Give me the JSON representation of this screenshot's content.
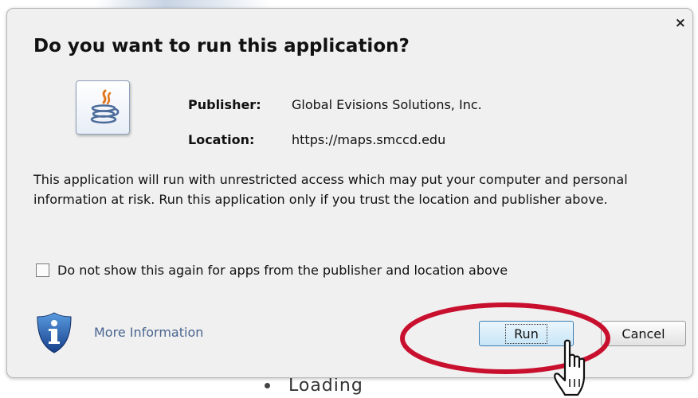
{
  "dialog": {
    "title": "Do you want to run this application?",
    "close_label": "×",
    "publisher_label": "Publisher:",
    "publisher_value": "Global Evisions Solutions, Inc.",
    "location_label": "Location:",
    "location_value": "https://maps.smccd.edu",
    "warning_text": "This application will run with unrestricted access which may put your computer and personal information at risk. Run this application only if you trust the location and publisher above.",
    "checkbox_label": "Do not show this again for apps from the publisher and location above",
    "checkbox_checked": false,
    "more_info_label": "More Information",
    "run_label": "Run",
    "cancel_label": "Cancel"
  },
  "background": {
    "loading_text": "Loading"
  },
  "icons": {
    "app_icon": "java-icon",
    "info_icon": "shield-info-icon",
    "cursor": "hand-pointer-icon"
  },
  "colors": {
    "dialog_bg": "#f0f0f0",
    "link": "#4a6590",
    "run_button_border": "#3c7fb1",
    "highlight": "#c8102e",
    "shield_blue": "#1f5fb4"
  }
}
